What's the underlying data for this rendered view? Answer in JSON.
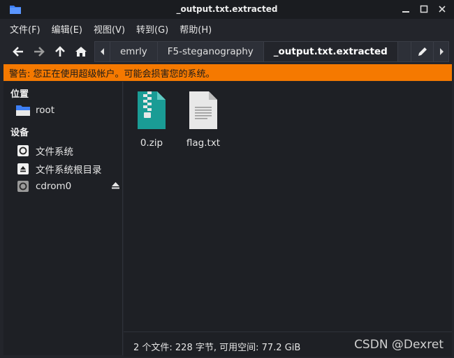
{
  "window": {
    "title": "_output.txt.extracted"
  },
  "menu": [
    "文件(F)",
    "编辑(E)",
    "视图(V)",
    "转到(G)",
    "帮助(H)"
  ],
  "pathbar": {
    "crumbs": [
      "emrly",
      "F5-steganography",
      "_output.txt.extracted"
    ],
    "active_index": 2
  },
  "warning": "警告: 您正在使用超级帐户。可能会损害您的系统。",
  "sidebar": {
    "places_heading": "位置",
    "places": [
      {
        "label": "root",
        "icon": "folder-icon"
      }
    ],
    "devices_heading": "设备",
    "devices": [
      {
        "label": "文件系统",
        "icon": "drive-icon"
      },
      {
        "label": "文件系统根目录",
        "icon": "eject-drive-icon"
      },
      {
        "label": "cdrom0",
        "icon": "cdrom-icon"
      }
    ]
  },
  "files": [
    {
      "name": "0.zip",
      "icon": "zip-archive-icon"
    },
    {
      "name": "flag.txt",
      "icon": "text-file-icon"
    }
  ],
  "status": "2 个文件: 228 字节, 可用空间: 77.2 GiB",
  "watermark": "CSDN @Dexret",
  "colors": {
    "warning_bg": "#f57900",
    "zip_teal": "#1a9c95",
    "folder_blue": "#3d7ff5"
  }
}
